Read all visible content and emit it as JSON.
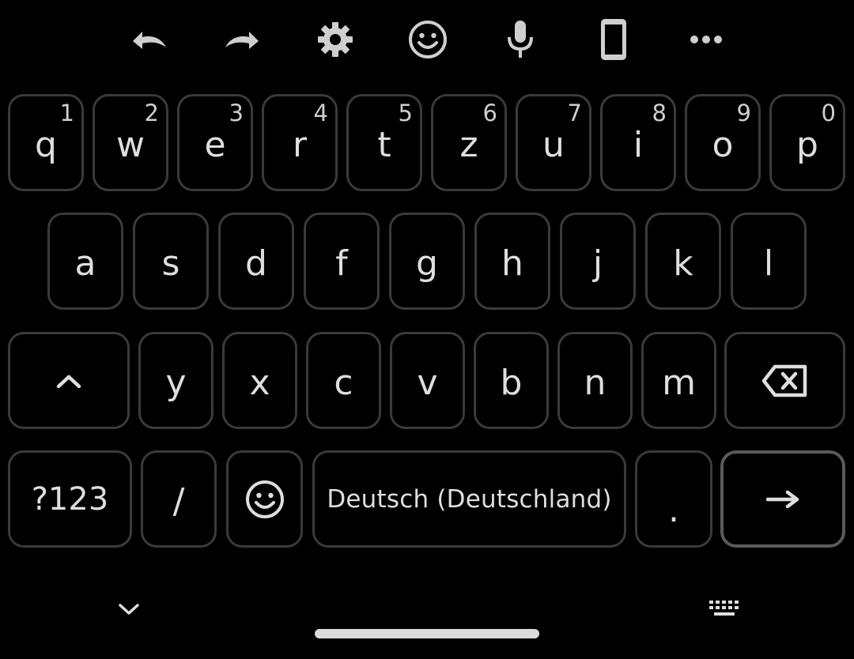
{
  "toolbar": {
    "icons": [
      "undo-icon",
      "redo-icon",
      "gear-icon",
      "smiley-icon",
      "microphone-icon",
      "phone-icon",
      "more-icon"
    ]
  },
  "rows": {
    "row1": [
      {
        "ch": "q",
        "hint": "1"
      },
      {
        "ch": "w",
        "hint": "2"
      },
      {
        "ch": "e",
        "hint": "3"
      },
      {
        "ch": "r",
        "hint": "4"
      },
      {
        "ch": "t",
        "hint": "5"
      },
      {
        "ch": "z",
        "hint": "6"
      },
      {
        "ch": "u",
        "hint": "7"
      },
      {
        "ch": "i",
        "hint": "8"
      },
      {
        "ch": "o",
        "hint": "9"
      },
      {
        "ch": "p",
        "hint": "0"
      }
    ],
    "row2": [
      "a",
      "s",
      "d",
      "f",
      "g",
      "h",
      "j",
      "k",
      "l"
    ],
    "row3": [
      "y",
      "x",
      "c",
      "v",
      "b",
      "n",
      "m"
    ]
  },
  "bottom_row": {
    "symbols_label": "?123",
    "slash_label": "/",
    "space_label": "Deutsch (Deutschland)",
    "period_label": "."
  },
  "colors": {
    "background": "#000000",
    "key_border": "#3a3a3a",
    "text": "#dedede"
  }
}
